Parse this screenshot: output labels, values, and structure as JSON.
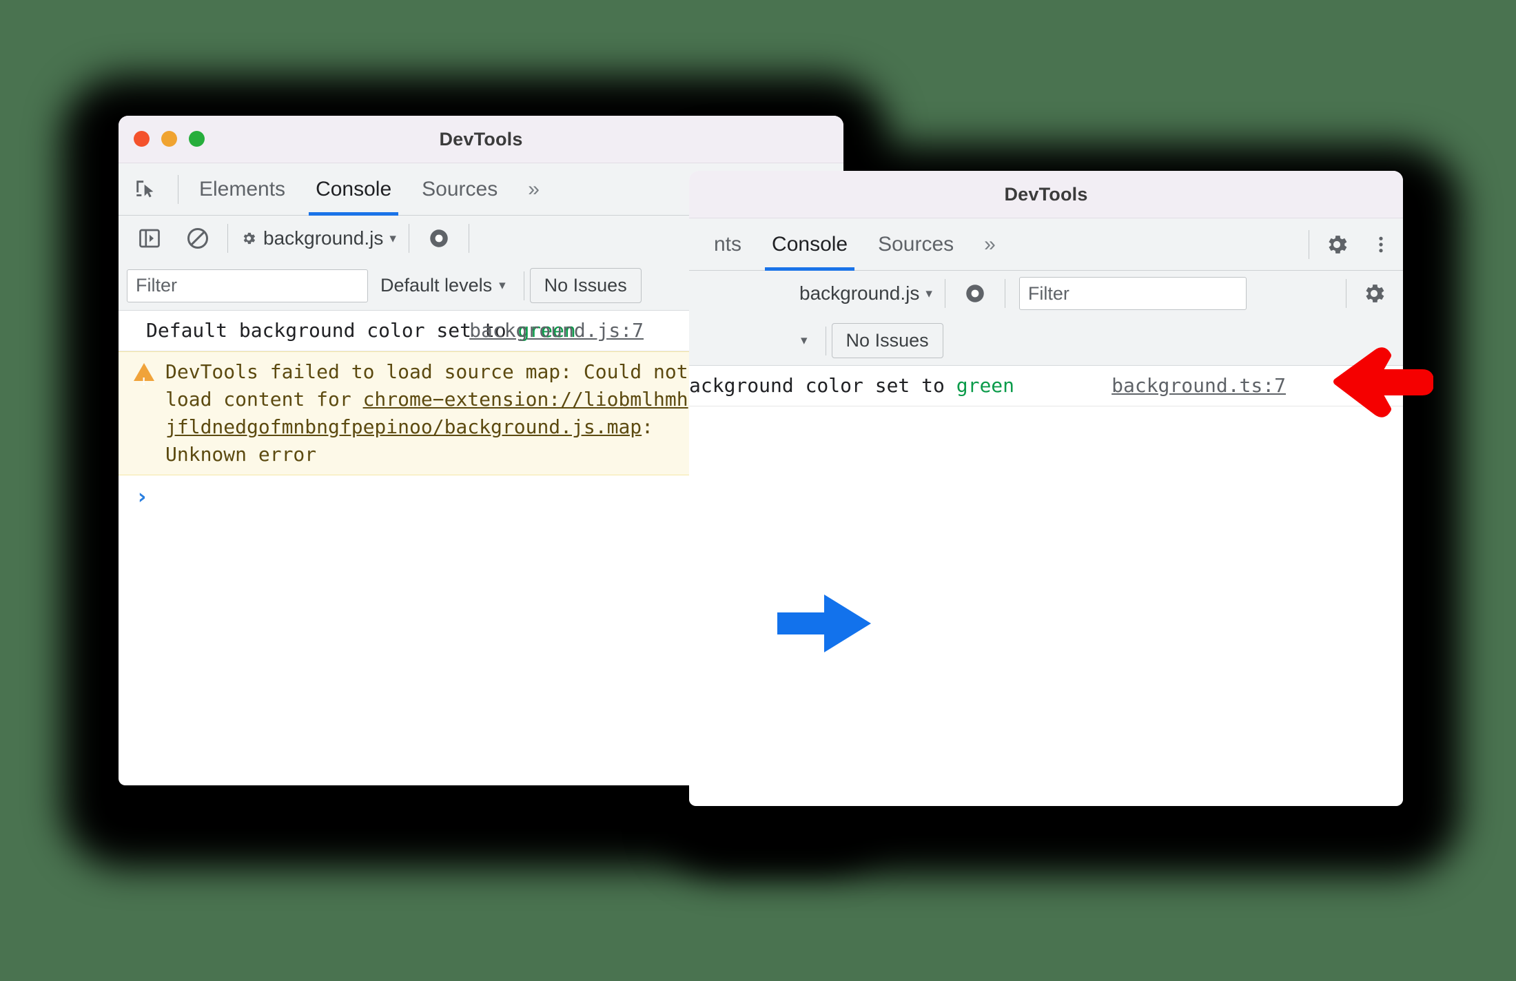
{
  "background_color": "#4a7350",
  "accent_color": "#1a73e8",
  "arrow_red": "#f50000",
  "arrow_blue": "#1272ec",
  "windows": [
    {
      "id": "left",
      "title": "DevTools",
      "traffic_lights": [
        "close-red",
        "minimize-yellow",
        "zoom-green"
      ],
      "tabs": [
        {
          "label": "Elements",
          "active": false
        },
        {
          "label": "Console",
          "active": true
        },
        {
          "label": "Sources",
          "active": false
        }
      ],
      "more_tabs_label": "»",
      "toolbar": {
        "sidebar_toggle_icon": "panel-toggle-icon",
        "clear_console_icon": "clear-console-icon",
        "context_label": "background.js",
        "context_caret": "▾",
        "context_gear_icon": "gear-small-icon",
        "eye_icon": "live-expression-eye-icon",
        "settings_icon": "gear-icon",
        "more_icon": "kebab-menu-icon"
      },
      "filter_row": {
        "filter_placeholder": "Filter",
        "levels_label": "Default levels",
        "levels_caret": "▾",
        "issues_label": "No Issues"
      },
      "messages": [
        {
          "type": "log",
          "text_before": "Default background color set to ",
          "highlight": "green",
          "source_link": "background.js:7"
        },
        {
          "type": "warning",
          "lines": [
            "DevTools failed to load source map: Could not",
            "load content for chrome−extension://liobmlhmh",
            "jfldnedgofmnbngfpepinoo/background.js.map:",
            "Unknown error"
          ],
          "link_text": "chrome−extension://liobmlhmh jfldnedgofmnbngfpepinoo/background.js.map",
          "trailing": "Unknown error"
        }
      ],
      "prompt_caret": "›"
    },
    {
      "id": "right",
      "title": "DevTools",
      "tabs": [
        {
          "label": "nts",
          "active": false
        },
        {
          "label": "Console",
          "active": true
        },
        {
          "label": "Sources",
          "active": false
        }
      ],
      "more_tabs_label": "»",
      "toolbar": {
        "context_label": "background.js",
        "context_caret": "▾",
        "eye_icon": "live-expression-eye-icon",
        "filter_placeholder": "Filter",
        "settings_icon": "gear-icon",
        "more_icon": "kebab-menu-icon"
      },
      "filter_row": {
        "levels_caret": "▾",
        "issues_label": "No Issues"
      },
      "messages": [
        {
          "type": "log",
          "text_before": "ackground color set to ",
          "highlight": "green",
          "source_link": "background.ts:7"
        }
      ]
    }
  ],
  "annotations": [
    {
      "name": "red-arrow-left-window",
      "direction": "left",
      "color": "#f50000"
    },
    {
      "name": "red-arrow-right-window",
      "direction": "left",
      "color": "#f50000"
    },
    {
      "name": "blue-arrow-transition",
      "direction": "right",
      "color": "#1272ec"
    }
  ]
}
